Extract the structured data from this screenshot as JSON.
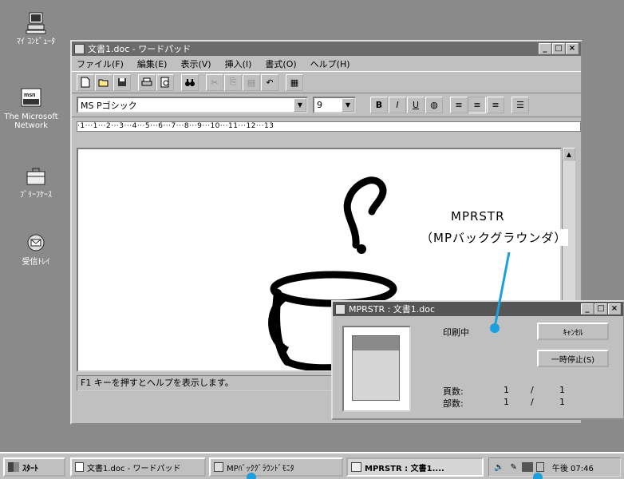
{
  "desktop": {
    "icons": [
      {
        "label": "ﾏｲ ｺﾝﾋﾟｭｰﾀ",
        "icon": "my-computer-icon"
      },
      {
        "label": "The Microsoft Network",
        "icon": "msn-icon"
      },
      {
        "label": "ﾌﾞﾘｰﾌｹｰｽ",
        "icon": "briefcase-icon"
      },
      {
        "label": "受信ﾄﾚｲ",
        "icon": "inbox-icon"
      }
    ]
  },
  "wordpad": {
    "title": "文書1.doc - ワードパッド",
    "menu": [
      "ファイル(F)",
      "編集(E)",
      "表示(V)",
      "挿入(I)",
      "書式(O)",
      "ヘルプ(H)"
    ],
    "font_name": "MS Pゴシック",
    "font_size": "9",
    "format_buttons": [
      "B",
      "I",
      "U"
    ],
    "ruler_text": "·1···1···2···3···4···5···6···7···8···9···10···11···12···13",
    "status": "F1 キーを押すとヘルプを表示します。"
  },
  "print_dialog": {
    "title": "MPRSTR : 文書1.doc",
    "status_text": "印刷中",
    "cancel_label": "ｷｬﾝｾﾙ",
    "pause_label": "一時停止(S)",
    "pages_label": "頁数:",
    "pages_current": "1",
    "pages_sep": "/",
    "pages_total": "1",
    "copies_label": "部数:",
    "copies_current": "1",
    "copies_sep": "/",
    "copies_total": "1"
  },
  "callout": {
    "line1": "MPRSTR",
    "line2": "（MPバックグラウンダ）",
    "color": "#1aa0dc"
  },
  "taskbar": {
    "start_label": "ｽﾀｰﾄ",
    "items": [
      {
        "label": "文書1.doc - ワードパッド",
        "active": false
      },
      {
        "label": "MPﾊﾞｯｸｸﾞﾗｳﾝﾄﾞﾓﾆﾀ",
        "active": false
      },
      {
        "label": "MPRSTR : 文書1....",
        "active": true
      }
    ],
    "clock": "午後 07:46"
  }
}
